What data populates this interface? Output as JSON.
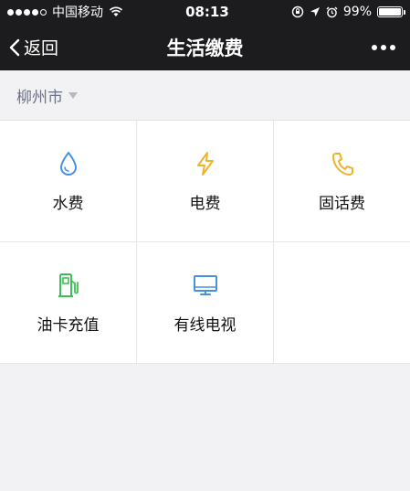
{
  "status_bar": {
    "carrier": "中国移动",
    "time": "08:13",
    "battery_level": "99%",
    "battery_fraction": 0.99
  },
  "nav": {
    "back_label": "返回",
    "title": "生活缴费"
  },
  "city": {
    "name": "柳州市"
  },
  "services": [
    {
      "label": "水费",
      "icon": "water-drop-icon",
      "color": "#4a90e2"
    },
    {
      "label": "电费",
      "icon": "lightning-icon",
      "color": "#f0b429"
    },
    {
      "label": "固话费",
      "icon": "phone-icon",
      "color": "#f0b429"
    },
    {
      "label": "油卡充值",
      "icon": "fuel-pump-icon",
      "color": "#3fbf5a"
    },
    {
      "label": "有线电视",
      "icon": "tv-monitor-icon",
      "color": "#4a90e2"
    }
  ]
}
